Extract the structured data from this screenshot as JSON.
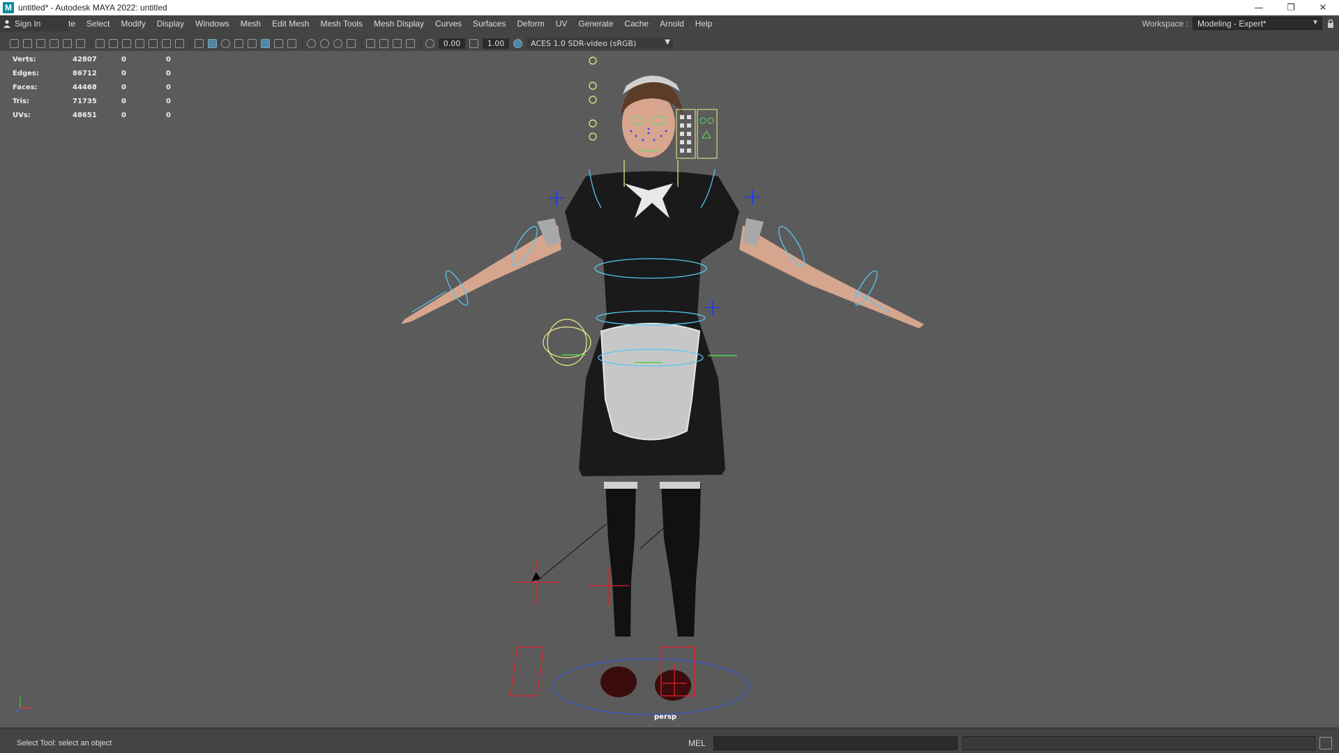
{
  "window": {
    "app_logo": "M",
    "title": "untitled* - Autodesk MAYA 2022: untitled",
    "controls": {
      "minimize": "—",
      "maximize": "❐",
      "close": "✕"
    }
  },
  "signin": {
    "label": "Sign In"
  },
  "menu": {
    "partial": "te",
    "items": [
      "Select",
      "Modify",
      "Display",
      "Windows",
      "Mesh",
      "Edit Mesh",
      "Mesh Tools",
      "Mesh Display",
      "Curves",
      "Surfaces",
      "Deform",
      "UV",
      "Generate",
      "Cache",
      "Arnold",
      "Help"
    ]
  },
  "workspace": {
    "label": "Workspace :",
    "value": "Modeling - Expert*"
  },
  "panel_toolbar": {
    "exposure": "0.00",
    "gamma": "1.00",
    "color_management": "ACES 1.0 SDR-video (sRGB)"
  },
  "hud": {
    "rows": [
      {
        "label": "Verts:",
        "value": "42807",
        "sel": "0",
        "comp": "0"
      },
      {
        "label": "Edges:",
        "value": "86712",
        "sel": "0",
        "comp": "0"
      },
      {
        "label": "Faces:",
        "value": "44468",
        "sel": "0",
        "comp": "0"
      },
      {
        "label": "Tris:",
        "value": "71735",
        "sel": "0",
        "comp": "0"
      },
      {
        "label": "UVs:",
        "value": "48651",
        "sel": "0",
        "comp": "0"
      }
    ]
  },
  "viewport": {
    "camera": "persp"
  },
  "status": {
    "help_line": "Select Tool: select an object",
    "command_type": "MEL"
  },
  "colors": {
    "viewport_bg": "#5b5b5b",
    "ui_bg": "#444444",
    "control_curve": "#55c8f0",
    "face_control": "#f0f08c",
    "ik_locator": "#e0202a"
  }
}
